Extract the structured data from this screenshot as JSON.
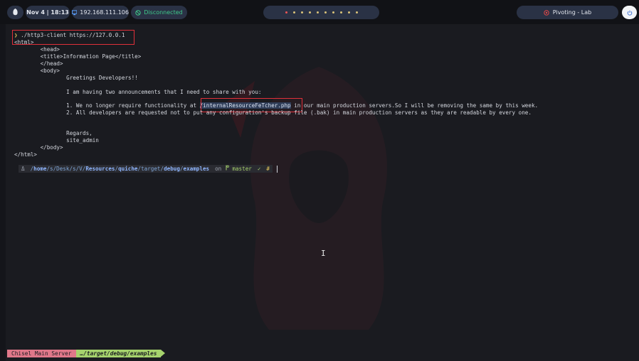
{
  "topbar": {
    "logo_icon": "tux-logo-icon",
    "date": "Nov 4 | 18:13",
    "ip": "192.168.111.106",
    "ip_icon": "monitor-icon",
    "vpn_status": "Disconnected",
    "vpn_icon": "shield-off-icon",
    "lab_title": "Pivoting - Lab",
    "lab_icon": "target-icon",
    "power_icon": "power-icon"
  },
  "terminal": {
    "command_arrow": "❯",
    "command": "./http3-client https://127.0.0.1",
    "output": [
      "<html>",
      "        <head>",
      "        <title>Information Page</title>",
      "        </head>",
      "        <body>",
      "                Greetings Developers!!",
      "",
      "                I am having two announcements that I need to share with you:",
      "",
      "                1. We no longer require functionality at ",
      "                2. All developers are requested not to put any configuration's backup file (.bak) in main production servers as they are readable by every one.",
      "",
      "",
      "                Regards,",
      "                site_admin",
      "        </body>",
      "</html>"
    ],
    "highlight_path": "/internalResourceFeTcher.php",
    "line1_tail": " in our main production servers.So I will be removing the same by this week.",
    "prompt": {
      "user_icon": "Δ",
      "path_prefix": "/",
      "path_parts": [
        "home",
        "/s/Desk/s/V/",
        "Resources",
        "/",
        "quiche",
        "/target/",
        "debug",
        "/",
        "examples"
      ],
      "on": "on",
      "branch_icon": "git-branch-icon",
      "branch": "master",
      "ok": "✓",
      "hash": "#"
    }
  },
  "statusbar": {
    "session": "Chisel Main Server",
    "path": "…/target/debug/examples"
  }
}
